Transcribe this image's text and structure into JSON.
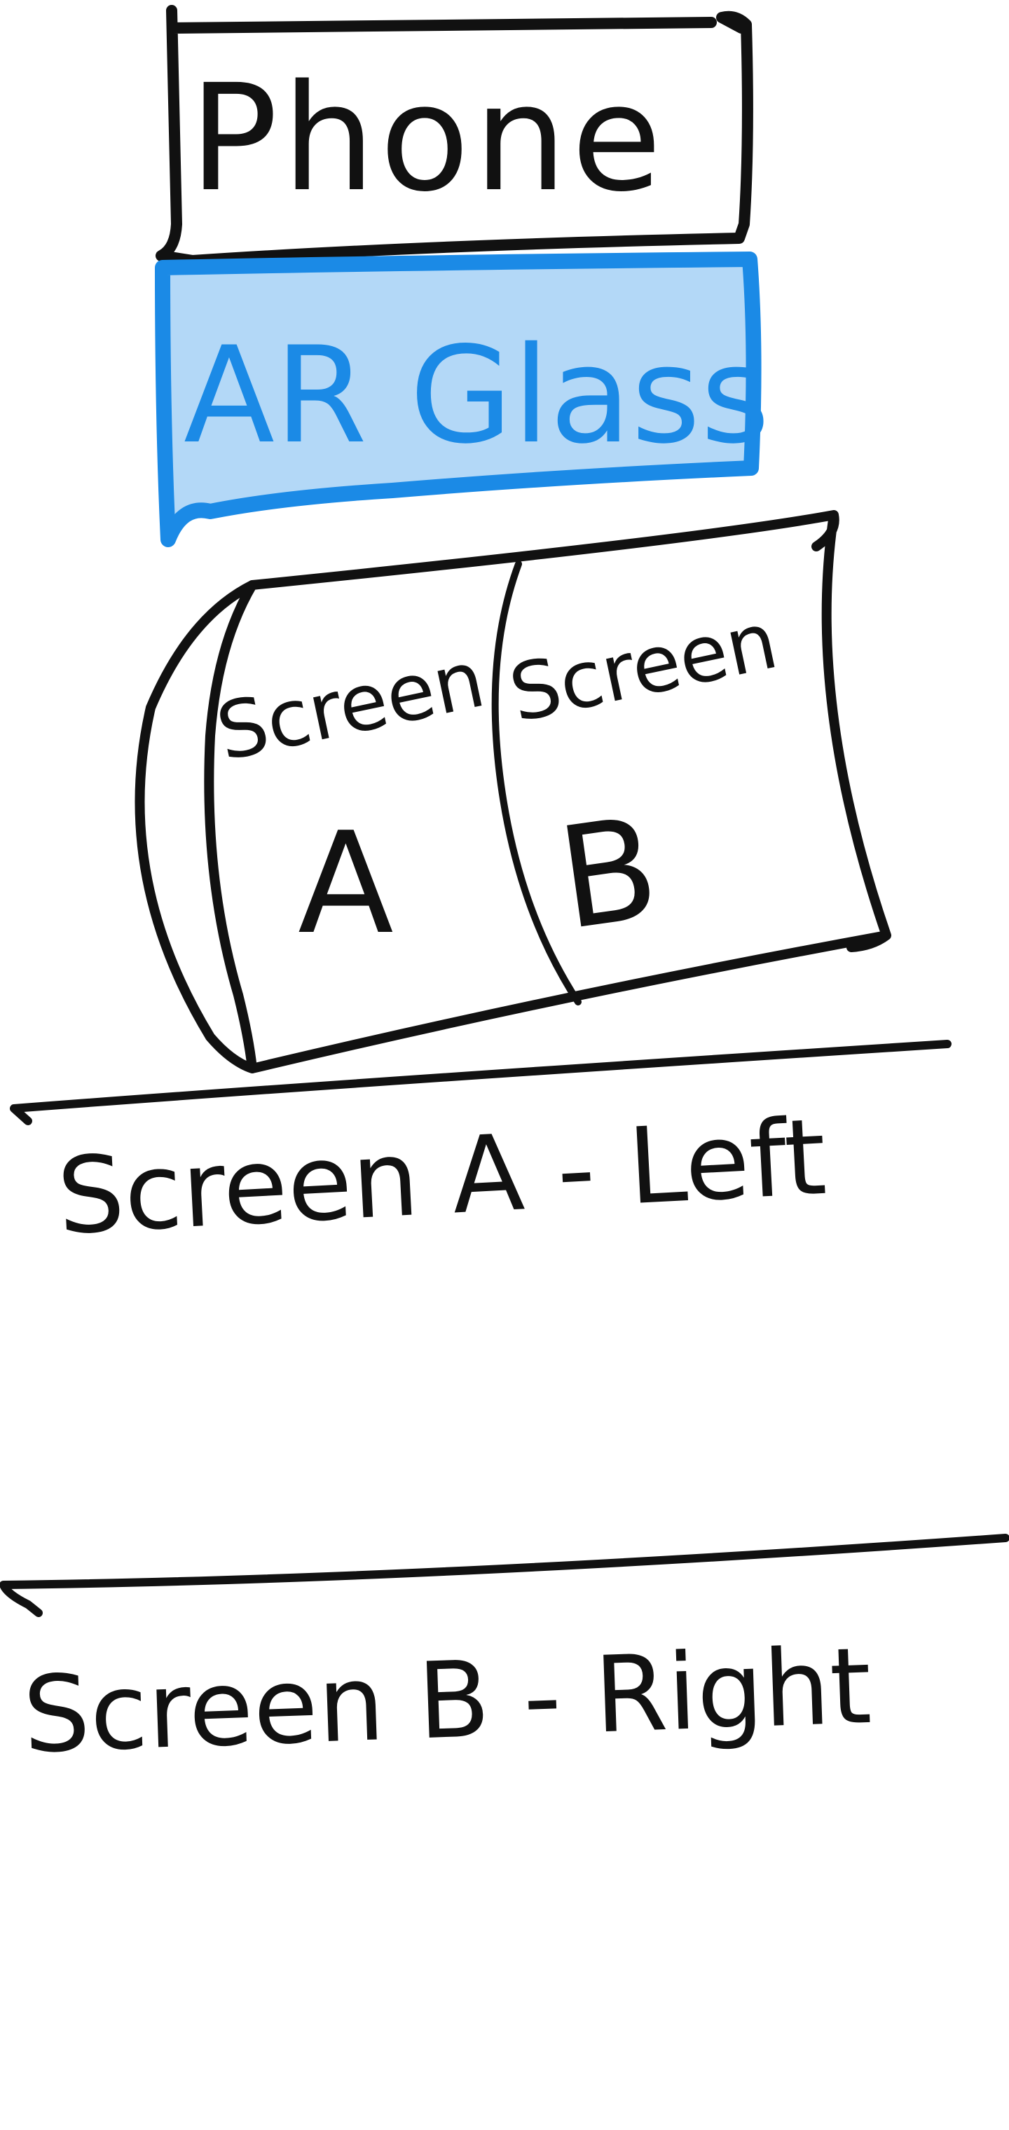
{
  "diagram": {
    "phone_box": {
      "label": "Phone"
    },
    "ar_glass_box": {
      "label": "AR Glass"
    },
    "curved_display": {
      "screen_a": {
        "word": "Screen",
        "letter": "A"
      },
      "screen_b": {
        "word": "Screen",
        "letter": "B"
      }
    },
    "sections": [
      {
        "label": "Screen A - Left"
      },
      {
        "label": "Screen B - Right"
      }
    ]
  },
  "colors": {
    "ink": "#111111",
    "ar_fill": "#b3d8f7",
    "ar_outline": "#1b8ae6",
    "ar_text": "#1b8ae6",
    "background": "#ffffff"
  }
}
